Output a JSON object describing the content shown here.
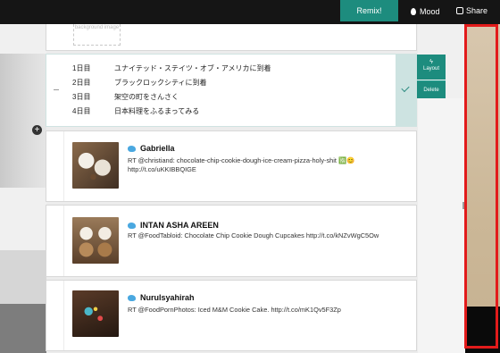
{
  "toolbar": {
    "remix_label": "Remix!",
    "mood_label": "Mood",
    "share_label": "Share"
  },
  "background_placeholder": "background image",
  "itinerary": {
    "rows": [
      {
        "day": "1日目",
        "text": "ユナイテッド・ステイツ・オブ・アメリカに到着"
      },
      {
        "day": "2日目",
        "text": "ブラックロックシティに到着"
      },
      {
        "day": "3日目",
        "text": "架空の町をさんさく"
      },
      {
        "day": "4日目",
        "text": "日本料理をふるまってみる"
      }
    ],
    "actions": {
      "layout_label": "Layout",
      "delete_label": "Delete"
    }
  },
  "tweets": [
    {
      "name": "Gabriella",
      "text": "RT @christiand: chocolate-chip-cookie-dough-ice-cream-pizza-holy-shit 🈯😊 http://t.co/uKKIBBQIGE"
    },
    {
      "name": "INTAN ASHA AREEN",
      "text": "RT @FoodTabloid: Chocolate Chip Cookie Dough Cupcakes http://t.co/kNZvWgC5Ow"
    },
    {
      "name": "Nurulsyahirah",
      "text": "RT @FoodPornPhotos: Iced M&M Cookie Cake. http://t.co/mK1Qv5F3Zp"
    }
  ],
  "colors": {
    "accent": "#1d8c7e",
    "highlight": "#e21b1b",
    "topbar": "#151515"
  }
}
